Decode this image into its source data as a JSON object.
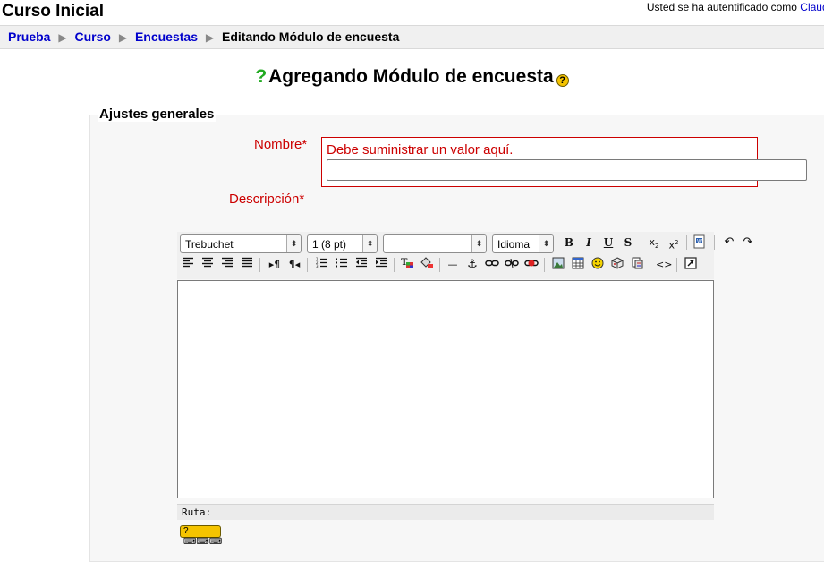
{
  "header": {
    "site_title": "Curso Inicial",
    "login_prefix": "Usted se ha autentificado como",
    "login_user": "Claudio Inve"
  },
  "breadcrumb": {
    "items": [
      "Prueba",
      "Curso",
      "Encuestas"
    ],
    "separator": "▶",
    "current": "Editando Módulo de encuesta"
  },
  "page": {
    "title": "Agregando Módulo de encuesta",
    "title_prefix": "?"
  },
  "form": {
    "section_title": "Ajustes generales",
    "name_label": "Nombre",
    "required_mark": "*",
    "name_error": "Debe suministrar un valor aquí.",
    "name_value": "",
    "description_label": "Descripción"
  },
  "editor": {
    "font": "Trebuchet",
    "size": "1 (8 pt)",
    "style": "",
    "language": "Idioma",
    "path_label": "Ruta:",
    "help_icon": "question-icon",
    "keyboard_icon": "keyboard-icon"
  },
  "colors": {
    "link": "#0000cc",
    "error": "#cc0000",
    "help_green": "#22aa22",
    "help_yellow": "#f5c400"
  }
}
